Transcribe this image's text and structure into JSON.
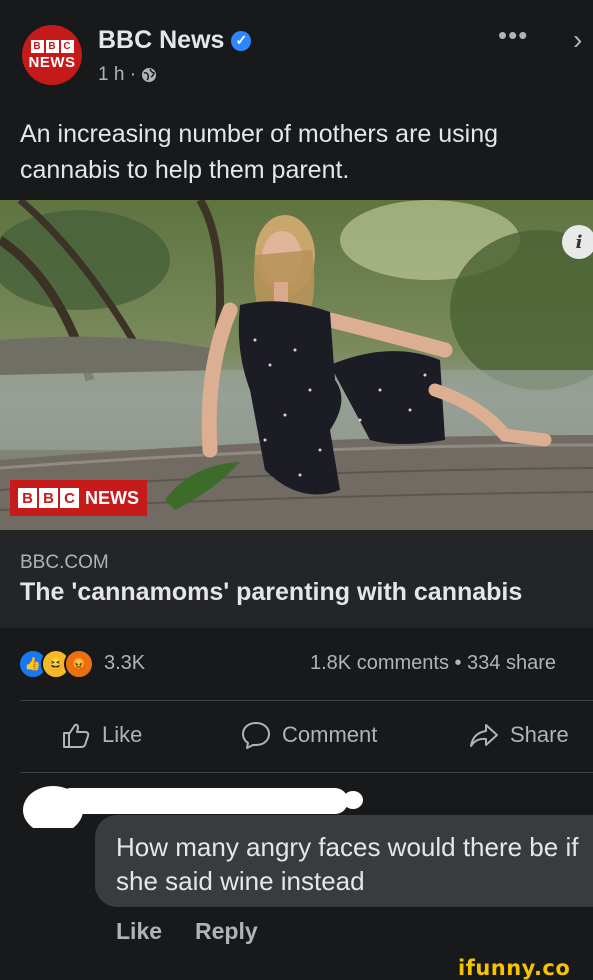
{
  "post": {
    "page_name": "BBC News",
    "timestamp": "1 h ·",
    "avatar_top": "BBC",
    "avatar_bottom": "NEWS",
    "caption": "An increasing number of mothers are using cannabis to help them parent.",
    "more_icon": "•••",
    "close_icon": "›"
  },
  "photo": {
    "badge_letters": [
      "B",
      "B",
      "C"
    ],
    "badge_text": "NEWS",
    "info_icon": "i"
  },
  "link": {
    "domain": "BBC.COM",
    "title": "The 'cannamoms' parenting with cannabis"
  },
  "stats": {
    "reaction_count": "3.3K",
    "comments_shares": "1.8K comments • 334 share",
    "reactions": [
      "like-icon",
      "haha-icon",
      "angry-icon"
    ]
  },
  "actions": {
    "like": "Like",
    "comment": "Comment",
    "share": "Share"
  },
  "comment": {
    "text": "How many angry faces would there be if she said wine instead",
    "like": "Like",
    "reply": "Reply"
  },
  "watermark": "ifunny.co"
}
